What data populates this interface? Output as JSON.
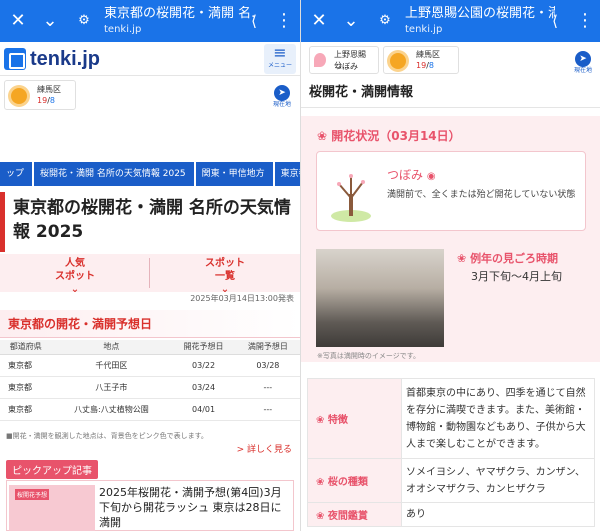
{
  "left": {
    "browser": {
      "title": "東京都の桜開花・満開 名...",
      "url": "tenki.jp"
    },
    "site": {
      "logo": "tenki.jp",
      "menu_label": "メニュー"
    },
    "weather": {
      "area": "練馬区",
      "high": "19",
      "low": "8",
      "location_label": "現在地"
    },
    "breadcrumbs": [
      "ップ",
      "桜開花・満開 名所の天気情報 2025",
      "関東・甲信地方",
      "東京都"
    ],
    "page_title": "東京都の桜開花・満開 名所の天気情報 2025",
    "tabs": [
      {
        "label": "人気\nスポット"
      },
      {
        "label": "スポット\n一覧"
      }
    ],
    "announce_date": "2025年03月14日13:00発表",
    "forecast": {
      "heading": "東京都の開花・満開予想日",
      "columns": [
        "都道府県",
        "地点",
        "開花予想日",
        "満開予想日"
      ],
      "rows": [
        [
          "東京都",
          "千代田区",
          "03/22",
          "03/28"
        ],
        [
          "東京都",
          "八王子市",
          "03/24",
          "---"
        ],
        [
          "東京都",
          "八丈島:八丈植物公園",
          "04/01",
          "---"
        ]
      ],
      "note": "■開花・満開を観測した地点は、背景色をピンク色で表します。",
      "more_label": "> 詳しく見る"
    },
    "pickup": {
      "label": "ピックアップ記事",
      "image_caption": "桜開花予想",
      "article": "2025年桜開花・満開予想(第4回)3月下旬から開花ラッシュ 東京は28日に満開"
    }
  },
  "right": {
    "browser": {
      "title": "上野恩賜公園の桜開花・満",
      "url": "tenki.jp"
    },
    "chips": {
      "spot": "上野恩賜公...",
      "status": "つぼみ",
      "area": "練馬区",
      "high": "19",
      "low": "8",
      "location_label": "現在地"
    },
    "section_title": "桜開花・満開情報",
    "bloom_heading": "開花状況（03月14日）",
    "bloom_status": "つぼみ",
    "bloom_desc": "満開前で、全くまたは殆ど開花していない状態",
    "season_heading": "例年の見ごろ時期",
    "season_value": "3月下旬〜4月上旬",
    "photo_note": "※写真は満開時のイメージです。",
    "info": [
      {
        "label": "特徴",
        "value": "首都東京の中にあり、四季を通じて自然を存分に満喫できます。また、美術館・博物館・動物園などもあり、子供から大人まで楽しむことができます。"
      },
      {
        "label": "桜の種類",
        "value": "ソメイヨシノ、ヤマザクラ、カンザン、オオシマザクラ、カンヒザクラ"
      },
      {
        "label": "夜間鑑賞",
        "value": "あり"
      }
    ]
  },
  "colors": {
    "browser_bar": "#1a73e8",
    "accent_red": "#d9302c",
    "sakura_pink": "#e8536b",
    "pink_bg": "#fdeef0"
  }
}
